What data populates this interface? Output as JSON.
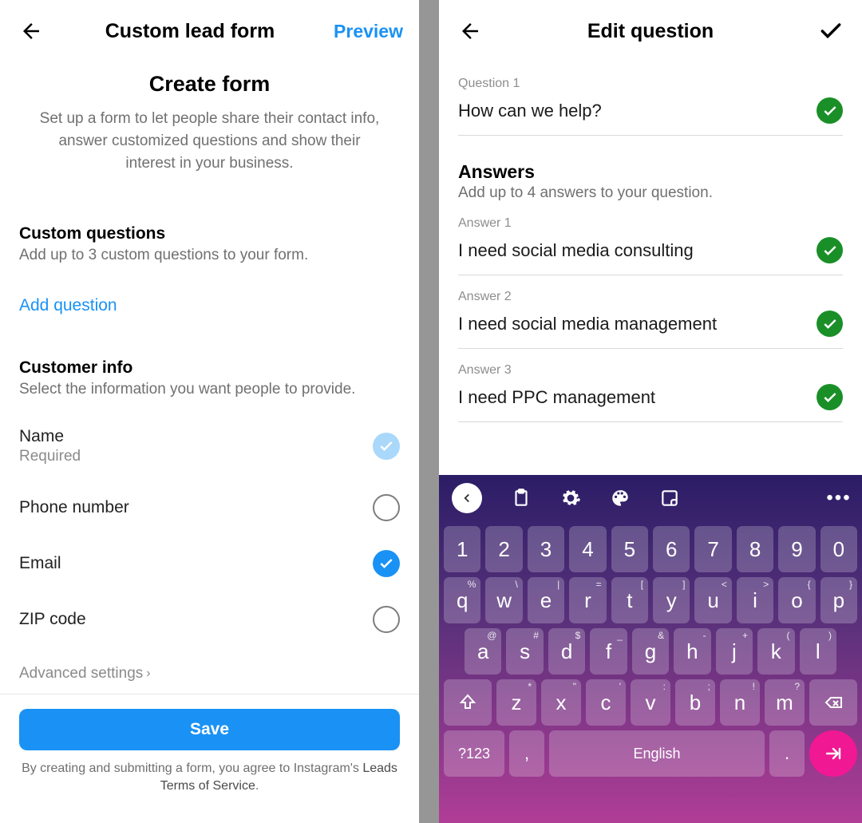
{
  "left": {
    "header": {
      "title": "Custom lead form",
      "preview": "Preview"
    },
    "page_title": "Create form",
    "page_desc": "Set up a form to let people share their contact info, answer customized questions and show their interest in your business.",
    "custom_q": {
      "title": "Custom questions",
      "sub": "Add up to 3 custom questions to your form.",
      "add": "Add question"
    },
    "info": {
      "title": "Customer info",
      "sub": "Select the information you want people to provide.",
      "rows": [
        {
          "label": "Name",
          "sub": "Required",
          "state": "locked"
        },
        {
          "label": "Phone number",
          "sub": "",
          "state": "off"
        },
        {
          "label": "Email",
          "sub": "",
          "state": "on"
        },
        {
          "label": "ZIP code",
          "sub": "",
          "state": "off"
        }
      ]
    },
    "advanced": "Advanced settings",
    "save": "Save",
    "terms_pre": "By creating and submitting a form, you agree to Instagram's ",
    "terms_link": "Leads Terms of Service",
    "terms_post": "."
  },
  "right": {
    "header": {
      "title": "Edit question"
    },
    "question": {
      "label": "Question 1",
      "value": "How can we help?"
    },
    "answers_title": "Answers",
    "answers_sub": "Add up to 4 answers to your question.",
    "answers": [
      {
        "label": "Answer 1",
        "value": "I need social media consulting"
      },
      {
        "label": "Answer 2",
        "value": "I need social media management"
      },
      {
        "label": "Answer 3",
        "value": "I need PPC management"
      }
    ]
  },
  "keyboard": {
    "row_num": [
      "1",
      "2",
      "3",
      "4",
      "5",
      "6",
      "7",
      "8",
      "9",
      "0"
    ],
    "row1": [
      {
        "k": "q",
        "s": "%"
      },
      {
        "k": "w",
        "s": "\\"
      },
      {
        "k": "e",
        "s": "|"
      },
      {
        "k": "r",
        "s": "="
      },
      {
        "k": "t",
        "s": "["
      },
      {
        "k": "y",
        "s": "]"
      },
      {
        "k": "u",
        "s": "<"
      },
      {
        "k": "i",
        "s": ">"
      },
      {
        "k": "o",
        "s": "{"
      },
      {
        "k": "p",
        "s": "}"
      }
    ],
    "row2": [
      {
        "k": "a",
        "s": "@"
      },
      {
        "k": "s",
        "s": "#"
      },
      {
        "k": "d",
        "s": "$"
      },
      {
        "k": "f",
        "s": "_"
      },
      {
        "k": "g",
        "s": "&"
      },
      {
        "k": "h",
        "s": "-"
      },
      {
        "k": "j",
        "s": "+"
      },
      {
        "k": "k",
        "s": "("
      },
      {
        "k": "l",
        "s": ")"
      }
    ],
    "row3": [
      {
        "k": "z",
        "s": "*"
      },
      {
        "k": "x",
        "s": "\""
      },
      {
        "k": "c",
        "s": "'"
      },
      {
        "k": "v",
        "s": ":"
      },
      {
        "k": "b",
        "s": ";"
      },
      {
        "k": "n",
        "s": "!"
      },
      {
        "k": "m",
        "s": "?"
      }
    ],
    "sym": "?123",
    "space": "English",
    "comma": ",",
    "dot": "."
  }
}
